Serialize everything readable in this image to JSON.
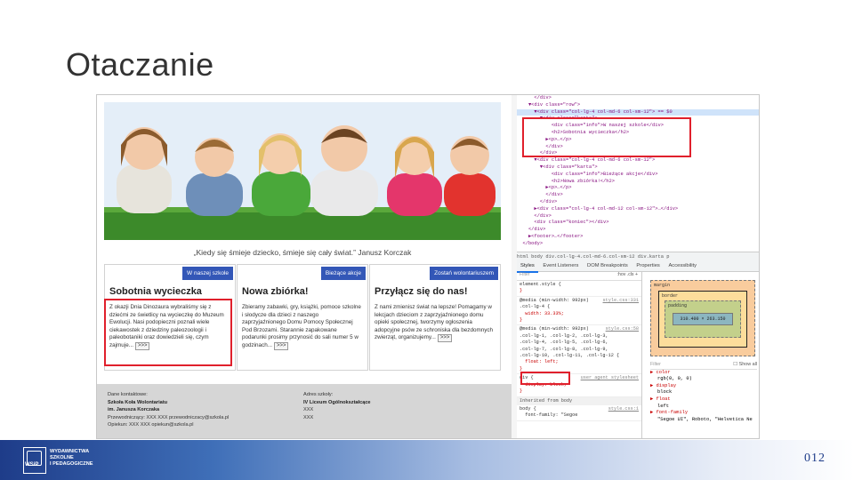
{
  "slide": {
    "title": "Otaczanie",
    "page_number": "012"
  },
  "site": {
    "quote": "„Kiedy się śmieje dziecko, śmieje się cały świat.” Janusz Korczak",
    "cards": [
      {
        "button": "W naszej szkole",
        "title": "Sobotnia wycieczka",
        "text": "Z okazji Dnia Dinozaura wybraliśmy się z dziećmi ze świetlicy na wycieczkę do Muzeum Ewolucji. Nasi podopieczni poznali wiele ciekawostek z dziedziny paleozoologii i paleobotaniki oraz dowiedzieli się, czym zajmuje...",
        "more": ">>>"
      },
      {
        "button": "Bieżące akcje",
        "title": "Nowa zbiórka!",
        "text": "Zbieramy zabawki, gry, książki, pomoce szkolne i słodycze dla dzieci z naszego zaprzyjaźnionego Domu Pomocy Społecznej Pod Brzozami. Starannie zapakowane podarunki prosimy przynosić do sali numer 5 w godzinach...",
        "more": ">>>"
      },
      {
        "button": "Zostań wolontariuszem",
        "title": "Przyłącz się do nas!",
        "text": "Z nami zmienisz świat na lepsze! Pomagamy w lekcjach dzieciom z zaprzyjaźnionego domu opieki społecznej, tworzymy ogłoszenia adopcyjne psów ze schroniska dla bezdomnych zwierząt, organizujemy...",
        "more": ">>>"
      }
    ],
    "footer": {
      "left_heading": "Dane kontaktowe:",
      "left_lines": [
        "Szkoła Koła Wolontariatu",
        "im. Janusza Korczaka",
        "Przewodniczący: XXX XXX przewodniczacy@szkola.pl",
        "Opiekun: XXX XXX opiekun@szkola.pl"
      ],
      "right_heading": "Adres szkoły:",
      "right_lines": [
        "IV Liceum Ogólnokształcące",
        "XXX",
        "XXX"
      ]
    }
  },
  "devtools": {
    "dom_lines": [
      "      </div>",
      "    ▼<div class=\"row\">",
      "      ▼<div class=\"col-lg-4 col-md-6 col-sm-12\"> == $0",
      "        ▼<div class=\"karta\">",
      "            <div class=\"info\">W naszej szkole</div>",
      "            <h2>Sobotnia wycieczka</h2>",
      "          ▶<p>…</p>",
      "          </div>",
      "        </div>",
      "      ▼<div class=\"col-lg-4 col-md-6 col-sm-12\">",
      "        ▼<div class=\"karta\">",
      "            <div class=\"info\">Bieżące akcje</div>",
      "            <h2>Nowa zbiórka!</h2>",
      "          ▶<p>…</p>",
      "          </div>",
      "        </div>",
      "      ▶<div class=\"col-lg-4 col-md-12 col-sm-12\">…</div>",
      "      </div>",
      "      <div class=\"koniec\"></div>",
      "    </div>",
      "    ▶<footer>…</footer>",
      "  </body>"
    ],
    "breadcrumbs": "html  body  div.col-lg-4.col-md-6.col-sm-12  div.karta  p",
    "tabs": [
      "Styles",
      "Event Listeners",
      "DOM Breakpoints",
      "Properties",
      "Accessibility"
    ],
    "filter_placeholder": "Filter",
    "filter_right": ":hov  .cls  +",
    "rules": [
      {
        "selector": "element.style {",
        "body": "}",
        "source": ""
      },
      {
        "selector": "@media (min-width: 992px)\n.col-lg-4 {",
        "body": "  width: 33.33%;\n}",
        "source": "style.css:331"
      },
      {
        "selector": "@media (min-width: 992px)\n.col-lg-1, .col-lg-2, .col-lg-3,\n.col-lg-4, .col-lg-5, .col-lg-6,\n.col-lg-7, .col-lg-8, .col-lg-9,\n.col-lg-10, .col-lg-11, .col-lg-12 {",
        "body": "  float: left;\n}",
        "source": "style.css:58"
      },
      {
        "selector": "div {",
        "body": "  display: block;\n}",
        "source": "user agent stylesheet"
      }
    ],
    "inherited_label": "Inherited from body",
    "inherited_rule": "body {\n  font-family: \"Segoe",
    "inherited_source": "style.css:1",
    "box": {
      "margin": "margin",
      "border": "border",
      "padding": "padding",
      "content": "310.400 × 263.150",
      "dash": "-"
    },
    "computed_filter": "Filter",
    "show_all": "Show all",
    "computed": [
      {
        "name": "color",
        "value": "rgb(0, 0, 0)"
      },
      {
        "name": "display",
        "value": "block"
      },
      {
        "name": "float",
        "value": "left"
      },
      {
        "name": "font-family",
        "value": "\"Segoe UI\", Roboto, \"Helvetica Ne"
      }
    ]
  },
  "branding": {
    "logo_text": "WYDAWNICTWA\nSZKOLNE\nI PEDAGOGICZNE",
    "logo_brand": "WSiP"
  },
  "colors": {
    "accent_blue": "#3357b7",
    "highlight_red": "#e0202c",
    "bar_blue": "#1e3c89"
  }
}
